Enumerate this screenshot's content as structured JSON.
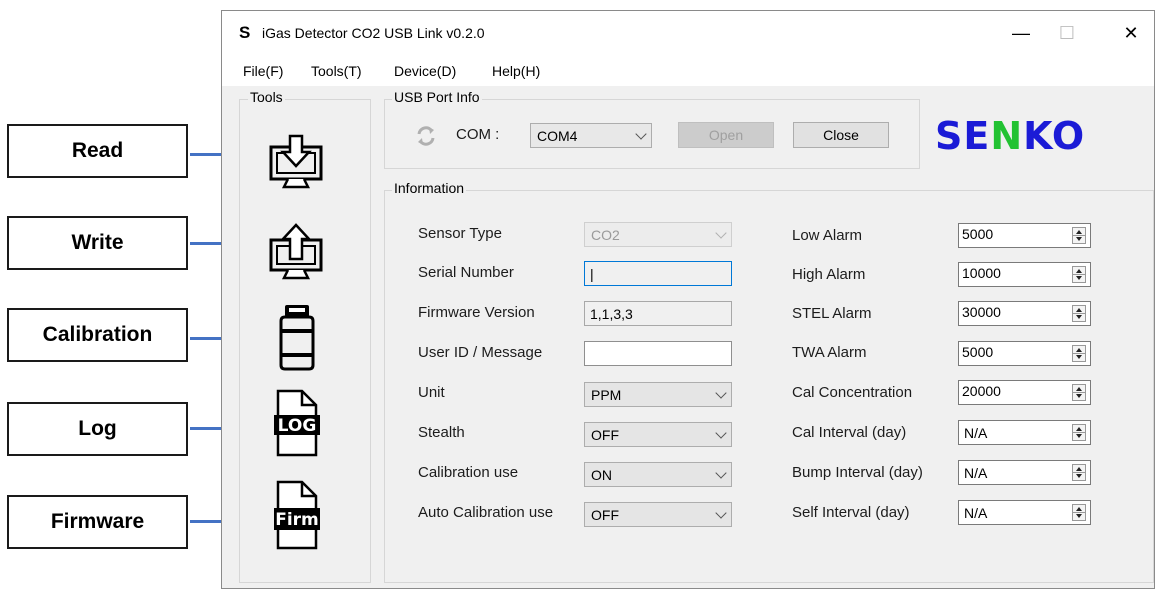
{
  "callouts": {
    "read": "Read",
    "write": "Write",
    "calibration": "Calibration",
    "log": "Log",
    "firmware": "Firmware"
  },
  "window": {
    "icon_letter": "S",
    "title": "iGas Detector CO2 USB Link  v0.2.0",
    "minimize": "—",
    "maximize": "☐",
    "close": "✕"
  },
  "menu": {
    "file": "File(F)",
    "tools": "Tools(T)",
    "device": "Device(D)",
    "help": "Help(H)"
  },
  "tools": {
    "group_label": "Tools",
    "log_icon_text": "LOG",
    "firm_icon_text": "Firm"
  },
  "usb": {
    "group_label": "USB Port Info",
    "com_label": "COM :",
    "com_value": "COM4",
    "open_label": "Open",
    "close_label": "Close"
  },
  "logo": {
    "part1": "SE",
    "part2": "N",
    "part3": "KO",
    "color_main": "#1b1bd6",
    "color_accent": "#22c232"
  },
  "info": {
    "group_label": "Information",
    "sensor_type": {
      "label": "Sensor Type",
      "value": "CO2"
    },
    "serial_number": {
      "label": "Serial Number",
      "value": "|"
    },
    "firmware_version": {
      "label": "Firmware Version",
      "value": "1,1,3,3"
    },
    "user_id": {
      "label": "User ID / Message",
      "value": ""
    },
    "unit": {
      "label": "Unit",
      "value": "PPM"
    },
    "stealth": {
      "label": "Stealth",
      "value": "OFF"
    },
    "calibration_use": {
      "label": "Calibration use",
      "value": "ON"
    },
    "auto_calibration_use": {
      "label": "Auto Calibration use",
      "value": "OFF"
    },
    "low_alarm": {
      "label": "Low Alarm",
      "value": "5000"
    },
    "high_alarm": {
      "label": "High Alarm",
      "value": "10000"
    },
    "stel_alarm": {
      "label": "STEL Alarm",
      "value": "30000"
    },
    "twa_alarm": {
      "label": "TWA Alarm",
      "value": "5000"
    },
    "cal_concentration": {
      "label": "Cal Concentration",
      "value": "20000"
    },
    "cal_interval": {
      "label": "Cal Interval (day)",
      "value": "N/A"
    },
    "bump_interval": {
      "label": "Bump Interval (day)",
      "value": "N/A"
    },
    "self_interval": {
      "label": "Self Interval (day)",
      "value": "N/A"
    }
  }
}
